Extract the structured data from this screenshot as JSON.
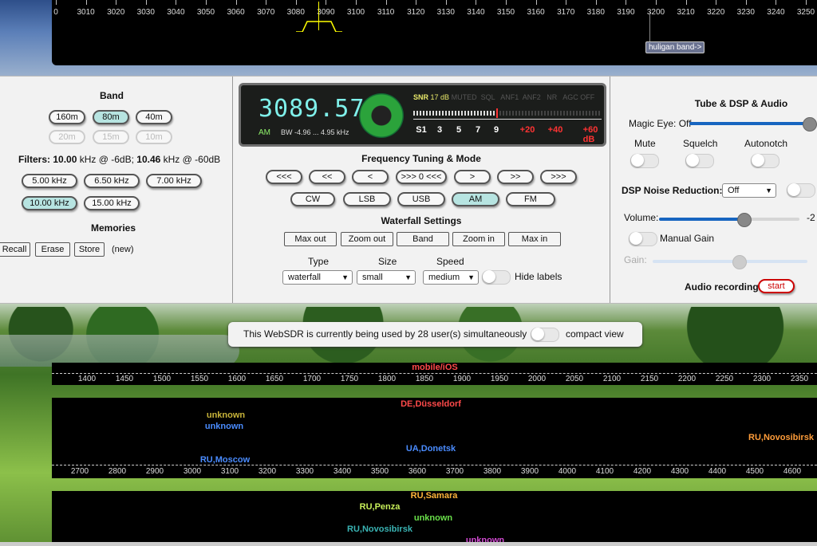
{
  "top_scale": {
    "ticks": [
      "0",
      "3010",
      "3020",
      "3030",
      "3040",
      "3050",
      "3060",
      "3070",
      "3080",
      "3090",
      "3100",
      "3110",
      "3120",
      "3130",
      "3140",
      "3150",
      "3160",
      "3170",
      "3180",
      "3190",
      "3200",
      "3210",
      "3220",
      "3230",
      "3240",
      "3250"
    ],
    "band_label": "huligan band->"
  },
  "band": {
    "title": "Band",
    "buttons": [
      {
        "label": "160m",
        "state": "normal"
      },
      {
        "label": "80m",
        "state": "selected"
      },
      {
        "label": "40m",
        "state": "normal"
      },
      {
        "label": "20m",
        "state": "disabled"
      },
      {
        "label": "15m",
        "state": "disabled"
      },
      {
        "label": "10m",
        "state": "disabled"
      }
    ]
  },
  "filters": {
    "prefix": "Filters:",
    "w1": "10.00",
    "t1": " kHz @ -6dB; ",
    "w2": "10.46",
    "t2": " kHz @ -60dB",
    "buttons": [
      "5.00 kHz",
      "6.50 kHz",
      "7.00 kHz",
      "10.00 kHz",
      "15.00 kHz"
    ]
  },
  "memories": {
    "title": "Memories",
    "buttons": [
      "Recall",
      "Erase",
      "Store"
    ],
    "status": "(new)"
  },
  "display": {
    "frequency": "3089.57",
    "mode": "AM",
    "bw": "BW  -4.96 ...  4.95 kHz",
    "snr_label": "SNR",
    "snr_value": "17 dB",
    "flags": "MUTED  SQL   ANF1  ANF2   NR   AGC OFF",
    "scale": [
      "S1",
      "3",
      "5",
      "7",
      "9",
      "+20",
      "+40",
      "+60 dB"
    ]
  },
  "tuning": {
    "title": "Frequency Tuning & Mode",
    "steps": [
      "<<<",
      "<<",
      "<",
      ">>> 0 <<<",
      ">",
      ">>",
      ">>>"
    ],
    "modes": [
      "CW",
      "LSB",
      "USB",
      "AM",
      "FM"
    ],
    "selected_mode": "AM"
  },
  "waterfall": {
    "title": "Waterfall Settings",
    "buttons": [
      "Max out",
      "Zoom out",
      "Band",
      "Zoom in",
      "Max in"
    ],
    "type_label": "Type",
    "type_value": "waterfall",
    "size_label": "Size",
    "size_value": "small",
    "speed_label": "Speed",
    "speed_value": "medium",
    "hide_labels": "Hide labels"
  },
  "dsp": {
    "title": "Tube & DSP & Audio",
    "magic_eye": "Magic Eye: Off",
    "mute": "Mute",
    "squelch": "Squelch",
    "autonotch": "Autonotch",
    "nr_label": "DSP Noise Reduction:",
    "nr_value": "Off",
    "volume": "Volume:",
    "volume_value": "-2",
    "volume_level": 0.6,
    "manual_gain": "Manual Gain",
    "gain": "Gain:",
    "recording": "Audio recording:",
    "start": "start"
  },
  "notice": {
    "text": "This WebSDR is currently being used by 28 user(s) simultaneously",
    "compact": "compact view"
  },
  "lower1": {
    "label": "mobile/iOS",
    "ticks": [
      "1400",
      "1450",
      "1500",
      "1550",
      "1600",
      "1650",
      "1700",
      "1750",
      "1800",
      "1850",
      "1900",
      "1950",
      "2000",
      "2050",
      "2100",
      "2150",
      "2200",
      "2250",
      "2300",
      "2350"
    ]
  },
  "lower2": {
    "spots": [
      {
        "text": "DE,Düsseldorf",
        "color": "#ff4a4a"
      },
      {
        "text": "unknown",
        "color": "#c8b43a"
      },
      {
        "text": "unknown",
        "color": "#4a8cff"
      },
      {
        "text": "RU,Novosibirsk",
        "color": "#ff9d3a"
      },
      {
        "text": "UA,Donetsk",
        "color": "#4a8cff"
      },
      {
        "text": "RU,Moscow",
        "color": "#4a8cff"
      }
    ],
    "ticks": [
      "2700",
      "2800",
      "2900",
      "3000",
      "3100",
      "3200",
      "3300",
      "3400",
      "3500",
      "3600",
      "3700",
      "3800",
      "3900",
      "4000",
      "4100",
      "4200",
      "4300",
      "4400",
      "4500",
      "4600"
    ]
  },
  "lower3": {
    "spots": [
      {
        "text": "RU,Samara",
        "color": "#ffb43a"
      },
      {
        "text": "RU,Penza",
        "color": "#c8f05a"
      },
      {
        "text": "unknown",
        "color": "#6ae04a"
      },
      {
        "text": "RU,Novosibirsk",
        "color": "#3ab4b4"
      },
      {
        "text": "unknown",
        "color": "#d24ad2"
      }
    ]
  }
}
